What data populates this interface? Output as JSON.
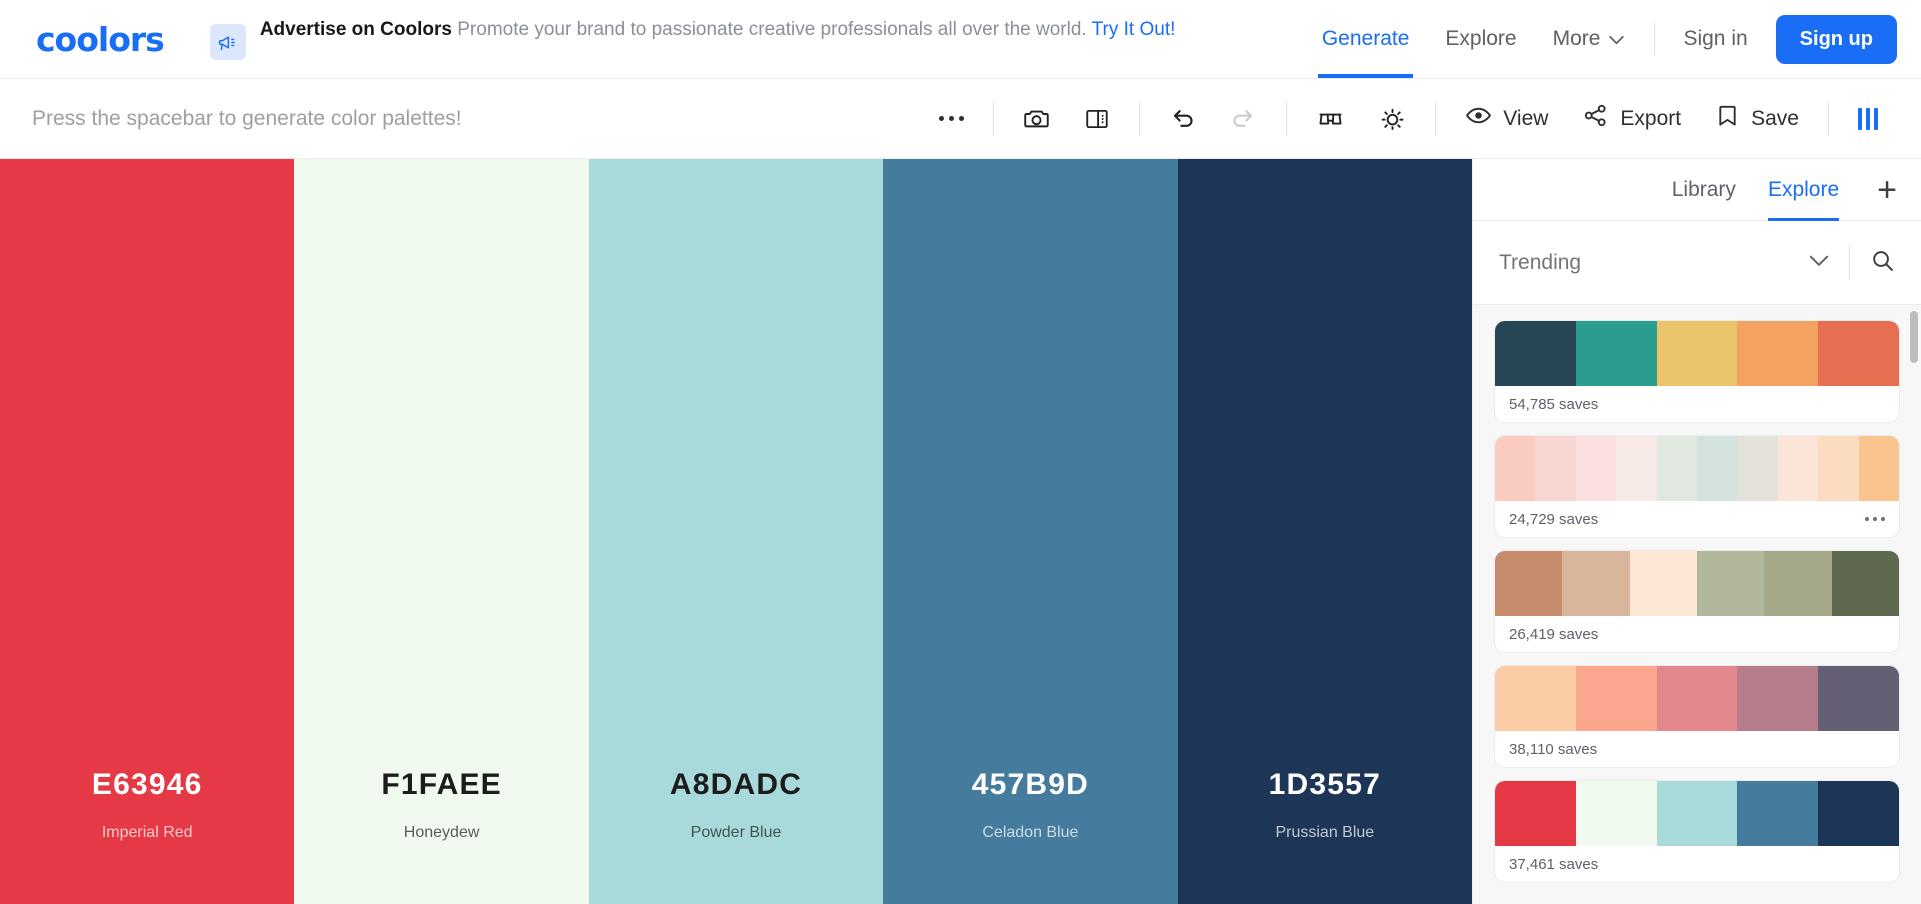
{
  "header": {
    "logo": "coolors",
    "ad": {
      "icon": "megaphone-icon",
      "title": "Advertise on Coolors",
      "description": "Promote your brand to passionate creative professionals all over the world.",
      "link": "Try It Out!"
    },
    "nav": [
      {
        "label": "Generate",
        "active": true
      },
      {
        "label": "Explore",
        "active": false
      },
      {
        "label": "More",
        "active": false,
        "has_chevron": true
      }
    ],
    "sign_in": "Sign in",
    "sign_up": "Sign up",
    "accent_color": "#1A6EF5"
  },
  "toolbar": {
    "hint": "Press the spacebar to generate color palettes!",
    "items": [
      {
        "name": "more-options-icon",
        "label": ""
      },
      {
        "name": "camera-icon",
        "label": ""
      },
      {
        "name": "layout-icon",
        "label": ""
      },
      {
        "name": "undo-icon",
        "label": ""
      },
      {
        "name": "redo-icon",
        "label": ""
      },
      {
        "name": "glasses-icon",
        "label": ""
      },
      {
        "name": "adjust-brightness-icon",
        "label": ""
      },
      {
        "name": "view-icon",
        "label": "View"
      },
      {
        "name": "share-icon",
        "label": "Export"
      },
      {
        "name": "bookmark-icon",
        "label": "Save"
      },
      {
        "name": "columns-icon",
        "label": ""
      }
    ],
    "view_label": "View",
    "export_label": "Export",
    "save_label": "Save"
  },
  "palette": {
    "swatches": [
      {
        "hex": "E63946",
        "name": "Imperial Red",
        "color": "#E63946",
        "text": "#ffffff"
      },
      {
        "hex": "F1FAEE",
        "name": "Honeydew",
        "color": "#F1FAEE",
        "text": "#1c1c1c"
      },
      {
        "hex": "A8DADC",
        "name": "Powder Blue",
        "color": "#A8DADC",
        "text": "#1c1c1c"
      },
      {
        "hex": "457B9D",
        "name": "Celadon Blue",
        "color": "#457B9D",
        "text": "#ffffff"
      },
      {
        "hex": "1D3557",
        "name": "Prussian Blue",
        "color": "#1D3557",
        "text": "#ffffff"
      }
    ]
  },
  "sidebar": {
    "tabs": [
      {
        "label": "Library",
        "active": false
      },
      {
        "label": "Explore",
        "active": true
      }
    ],
    "add_label": "+",
    "filter": {
      "label": "Trending",
      "chevron": "chevron-down-icon",
      "search": "search-icon"
    },
    "saves_suffix": "saves",
    "cards": [
      {
        "saves": "54,785 saves",
        "colors": [
          "#264653",
          "#2A9D8F",
          "#E9C46A",
          "#F4A261",
          "#E76F51"
        ],
        "has_menu": false
      },
      {
        "saves": "24,729 saves",
        "colors": [
          "#FACCBF",
          "#F8D6D2",
          "#F9DFDF",
          "#F7E9E6",
          "#E1E8E0",
          "#D4E2DD",
          "#E3E1DA",
          "#FBE4D8",
          "#FBDCC0",
          "#F9C48E"
        ],
        "has_menu": true
      },
      {
        "saves": "26,419 saves",
        "colors": [
          "#C68B6B",
          "#D9B69B",
          "#FDE8D4",
          "#B0B79C",
          "#A4A888",
          "#5F6950"
        ],
        "has_menu": false
      },
      {
        "saves": "38,110 saves",
        "colors": [
          "#FBCDA7",
          "#FBA68E",
          "#E2878B",
          "#B57C8C",
          "#645F74"
        ],
        "has_menu": false
      },
      {
        "saves": "37,461 saves",
        "colors": [
          "#E63946",
          "#F1FAEE",
          "#A8DADC",
          "#457B9D",
          "#1D3557"
        ],
        "has_menu": false
      }
    ]
  }
}
